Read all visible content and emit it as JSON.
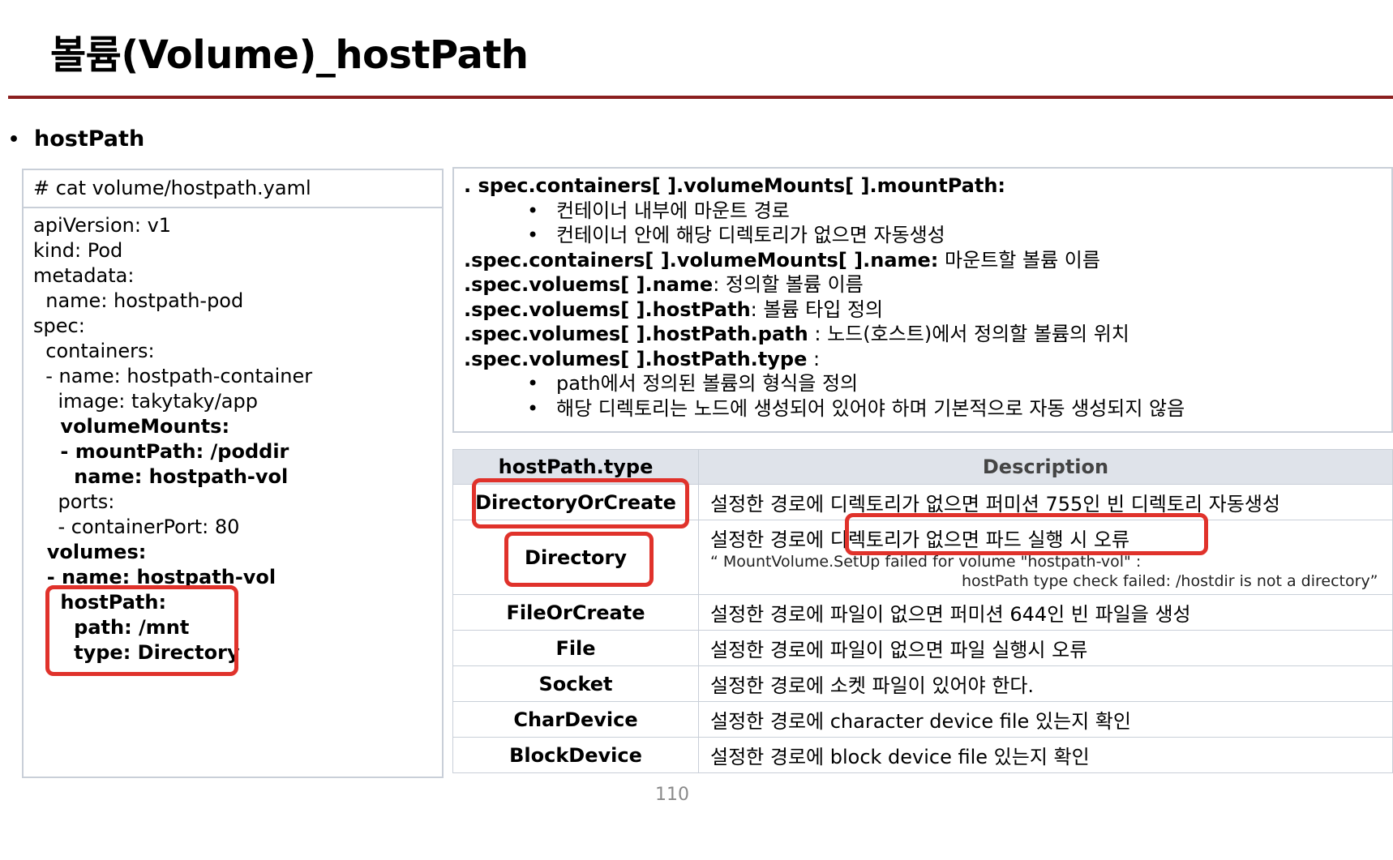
{
  "title": "볼륨(Volume)_hostPath",
  "section": {
    "bullet": "•",
    "label": "hostPath"
  },
  "code": {
    "header": "# cat volume/hostpath.yaml",
    "lines": [
      {
        "text": "apiVersion: v1",
        "bold": false
      },
      {
        "text": "kind: Pod",
        "bold": false
      },
      {
        "text": "metadata:",
        "bold": false
      },
      {
        "text": "  name: hostpath-pod",
        "bold": false
      },
      {
        "text": "spec:",
        "bold": false
      },
      {
        "text": "  containers:",
        "bold": false
      },
      {
        "text": "  - name: hostpath-container",
        "bold": false
      },
      {
        "text": "    image: takytaky/app",
        "bold": false
      },
      {
        "text": "    volumeMounts:",
        "bold": true
      },
      {
        "text": "    - mountPath: /poddir",
        "bold": true
      },
      {
        "text": "      name: hostpath-vol",
        "bold": true
      },
      {
        "text": "    ports:",
        "bold": false
      },
      {
        "text": "    - containerPort: 80",
        "bold": false
      },
      {
        "text": "  volumes:",
        "bold": true
      },
      {
        "text": "  - name: hostpath-vol",
        "bold": true
      },
      {
        "text": "    hostPath:",
        "bold": true
      },
      {
        "text": "      path: /mnt",
        "bold": true
      },
      {
        "text": "      type: Directory",
        "bold": true
      }
    ]
  },
  "spec": {
    "l1_key": ". spec.containers[ ].volumeMounts[ ].mountPath:",
    "l1_sub1": "컨테이너 내부에 마운트 경로",
    "l1_sub2": "컨테이너 안에 해당 디렉토리가 없으면 자동생성",
    "l2_key": ".spec.containers[ ].volumeMounts[ ].name:",
    "l2_val": " 마운트할 볼륨 이름",
    "l3_key": ".spec.voluems[ ].name",
    "l3_val": ": 정의할 볼륨 이름",
    "l4_key": ".spec.voluems[ ].hostPath",
    "l4_val": ": 볼륨 타입 정의",
    "l5_key": ".spec.volumes[ ].hostPath.path",
    "l5_val": " : 노드(호스트)에서 정의할 볼륨의 위치",
    "l6_key": ".spec.volumes[ ].hostPath.type",
    "l6_val": " :",
    "l6_sub1": "path에서 정의된 볼륨의 형식을 정의",
    "l6_sub2": "해당 디렉토리는 노드에 생성되어 있어야 하며 기본적으로 자동 생성되지 않음"
  },
  "table": {
    "headers": [
      "hostPath.type",
      "Description"
    ],
    "rows": [
      {
        "type": "DirectoryOrCreate",
        "desc": "설정한 경로에 디렉토리가 없으면 퍼미션 755인 빈 디렉토리 자동생성"
      },
      {
        "type": "Directory",
        "desc": "설정한 경로에 디렉토리가 없으면 파드 실행 시 오류",
        "err1": "“ MountVolume.SetUp failed for volume \"hostpath-vol\" :",
        "err2": "hostPath type check failed: /hostdir is not a directory”"
      },
      {
        "type": "FileOrCreate",
        "desc": "설정한 경로에 파일이 없으면 퍼미션 644인 빈 파일을 생성"
      },
      {
        "type": "File",
        "desc": "설정한 경로에 파일이 없으면 파일 실행시 오류"
      },
      {
        "type": "Socket",
        "desc": "설정한 경로에 소켓 파일이 있어야 한다."
      },
      {
        "type": "CharDevice",
        "desc": "설정한 경로에 character device file 있는지 확인"
      },
      {
        "type": "BlockDevice",
        "desc": "설정한 경로에 block device file 있는지 확인"
      }
    ]
  },
  "page_number": "110",
  "colors": {
    "title_rule": "#8b1f1f",
    "highlight": "#e0322b",
    "border": "#c9cfd8",
    "header_bg": "#dfe3ea"
  }
}
